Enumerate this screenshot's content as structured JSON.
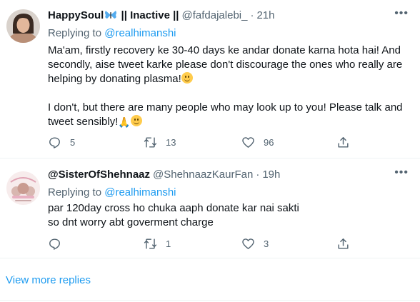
{
  "tweets": [
    {
      "name": "HappySoul",
      "name_suffix": " || Inactive ||",
      "handle": "@fafdajalebi_",
      "time": "21h",
      "replying_prefix": "Replying to ",
      "replying_to": "@realhimanshi",
      "body_p1": "Ma'am, firstly recovery ke 30-40 days ke andar donate karna hota hai! And secondly, aise tweet karke please don't discourage the ones who really are helping by donating plasma!",
      "body_p2": "I don't, but there are many people who may look up to you! Please talk and tweet sensibly!",
      "replies": "5",
      "retweets": "13",
      "likes": "96",
      "icons": [
        "butterfly-emoji",
        "smile-emoji",
        "folded-hands-emoji"
      ]
    },
    {
      "name": "@SisterOfShehnaaz",
      "handle": "@ShehnaazKaurFan",
      "time": "19h",
      "replying_prefix": "Replying to ",
      "replying_to": "@realhimanshi",
      "body_l1": "par 120day cross ho chuka aaph donate kar nai sakti",
      "body_l2": "so dnt worry abt goverment charge",
      "replies": "",
      "retweets": "1",
      "likes": "3"
    }
  ],
  "view_more": "View more replies",
  "colors": {
    "link": "#1d9bf0",
    "secondary": "#536471",
    "primary": "#0f1419"
  }
}
